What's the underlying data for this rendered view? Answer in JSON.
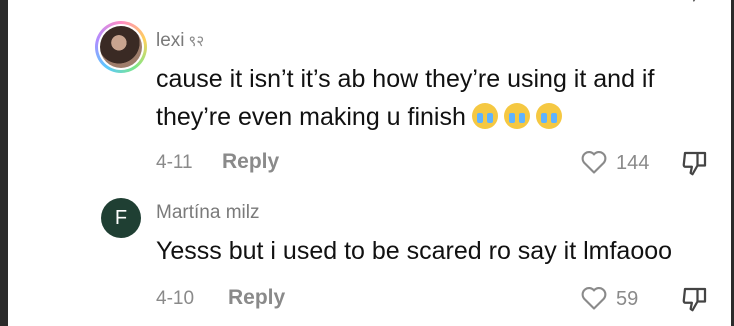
{
  "comments": [
    {
      "username": "lexi",
      "username_suffix": "९२",
      "text_line1": "cause it isn’t it’s ab how they’re using it and if",
      "text_line2": "they’re even making u finish",
      "date": "4-11",
      "reply_label": "Reply",
      "likes": "144"
    },
    {
      "avatar_letter": "F",
      "avatar_color": "#1f3f33",
      "username": "Martína milz",
      "text": "Yesss but i used to be scared ro say it lmfaooo",
      "date": "4-10",
      "reply_label": "Reply",
      "likes": "59"
    }
  ],
  "icons": {
    "like": "heart-outline-icon",
    "dislike": "thumbs-down-outline-icon",
    "emoji": "loudly-crying-face-emoji"
  }
}
